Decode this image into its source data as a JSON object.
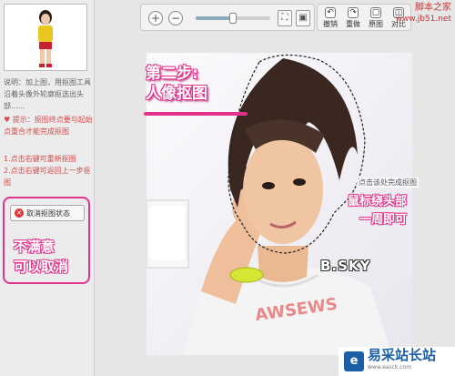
{
  "left_panel": {
    "description": "说明：加上图，用抠图工具沿着头像外轮廓抠选出头部......",
    "hint": "提示：抠图终点要与起始点重合才能完成抠图",
    "step1": "1.点击右键可重新抠图",
    "step2": "2.点击右键可返回上一步抠图",
    "cancel_button": "取消抠图状态",
    "cancel_note_line1": "不满意",
    "cancel_note_line2": "可以取消"
  },
  "toolbar": {
    "zoom_in": "+",
    "zoom_out": "−",
    "zoom_level": 0.5,
    "undo_label": "撤销",
    "redo_label": "重做",
    "original_label": "原图",
    "compare_label": "对比"
  },
  "watermark": {
    "line1": "脚本之家",
    "line2": "www.jb51.net"
  },
  "canvas": {
    "step_line1": "第二步:",
    "step_line2": "人像抠图",
    "tip_text": "点击该处完成抠图",
    "mouse_note_line1": "鼠标绕头部",
    "mouse_note_line2": "一周即可",
    "shirt_text": "B.SKY"
  },
  "footer": {
    "logo_char": "e",
    "site_name": "易采站长站",
    "site_url": "www.easck.com"
  },
  "colors": {
    "accent_pink": "#e0338c",
    "hint_red": "#d84a4a",
    "panel_bg": "#e6e6e6",
    "logo_blue": "#1b5fa6"
  },
  "icons": [
    "zoom-in-icon",
    "zoom-out-icon",
    "fit-icon",
    "actual-size-icon",
    "undo-icon",
    "redo-icon",
    "original-icon",
    "compare-icon",
    "heart-icon",
    "close-icon"
  ]
}
